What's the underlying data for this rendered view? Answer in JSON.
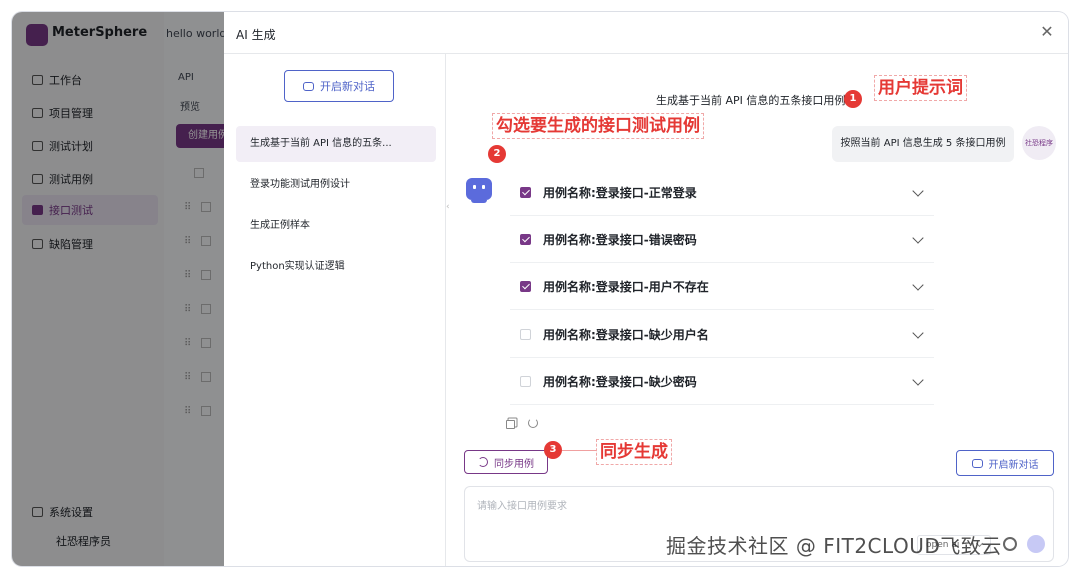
{
  "background_app": {
    "brand": "MeterSphere",
    "project_name": "hello world",
    "nav_items": [
      {
        "label": "工作台",
        "active": false
      },
      {
        "label": "项目管理",
        "active": false
      },
      {
        "label": "测试计划",
        "active": false
      },
      {
        "label": "测试用例",
        "active": false
      },
      {
        "label": "接口测试",
        "active": true
      },
      {
        "label": "缺陷管理",
        "active": false
      }
    ],
    "bottom_items": [
      "系统设置",
      "社恐程序员"
    ],
    "main_tab": "API",
    "sub_tab": "预览",
    "create_button": "创建用例"
  },
  "drawer": {
    "title": "AI 生成",
    "new_conversation_label": "开启新对话",
    "conversations": [
      {
        "label": "生成基于当前 API 信息的五条...",
        "active": true
      },
      {
        "label": "登录功能测试用例设计",
        "active": false
      },
      {
        "label": "生成正例样本",
        "active": false
      },
      {
        "label": "Python实现认证逻辑",
        "active": false
      }
    ]
  },
  "chat": {
    "heading": "生成基于当前 API 信息的五条接口用例",
    "user_message": "按照当前 API 信息生成 5 条接口用例",
    "user_avatar_label": "社恐程序",
    "cases": [
      {
        "label": "用例名称:登录接口-正常登录",
        "checked": true
      },
      {
        "label": "用例名称:登录接口-错误密码",
        "checked": true
      },
      {
        "label": "用例名称:登录接口-用户不存在",
        "checked": true
      },
      {
        "label": "用例名称:登录接口-缺少用户名",
        "checked": false
      },
      {
        "label": "用例名称:登录接口-缺少密码",
        "checked": false
      }
    ],
    "sync_button": "同步用例",
    "new_conversation_button": "开启新对话",
    "input_placeholder": "请输入接口用例要求",
    "model": "open ai"
  },
  "annotations": [
    {
      "number": "1",
      "text": "用户提示词"
    },
    {
      "number": "2",
      "text": "勾选要生成的接口测试用例"
    },
    {
      "number": "3",
      "text": "同步生成"
    }
  ],
  "watermark": "掘金技术社区 @ FIT2CLOUD飞致云",
  "colors": {
    "brand_purple": "#783887",
    "accent_blue": "#4f63c8",
    "annotation_red": "#e53935"
  }
}
